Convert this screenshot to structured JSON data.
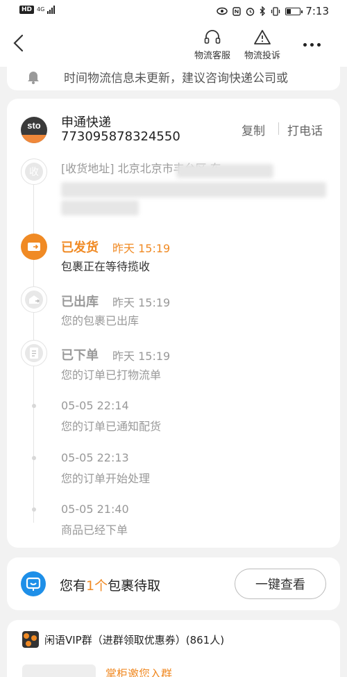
{
  "status_bar": {
    "hd": "HD",
    "network": "4G",
    "time": "7:13"
  },
  "nav": {
    "service_label": "物流客服",
    "complaint_label": "物流投诉"
  },
  "notice": {
    "text": "时间物流信息未更新，建议咨询快递公司或"
  },
  "shipment": {
    "carrier": "申通快递",
    "tracking_number": "773095878324550",
    "copy_label": "复制",
    "call_label": "打电话",
    "logo_text": "sto",
    "receive_label": "收",
    "address": "[收货地址] 北京北京市丰台区 东"
  },
  "timeline": [
    {
      "status": "已发货",
      "time": "昨天 15:19",
      "desc": "包裹正在等待揽收"
    },
    {
      "status": "已出库",
      "time": "昨天 15:19",
      "desc": "您的包裹已出库"
    },
    {
      "status": "已下单",
      "time": "昨天 15:19",
      "desc": "您的订单已打物流单"
    },
    {
      "time": "05-05 22:14",
      "desc": "您的订单已通知配货"
    },
    {
      "time": "05-05 22:13",
      "desc": "您的订单开始处理"
    },
    {
      "time": "05-05 21:40",
      "desc": "商品已经下单"
    }
  ],
  "pickup": {
    "prefix": "您有",
    "count": "1个",
    "suffix": "包裹待取",
    "button": "一键查看"
  },
  "group": {
    "title": "闲语VIP群（进群领取优惠券）(861人)",
    "invite": "掌柜邀您入群"
  },
  "colors": {
    "accent": "#f08a24",
    "pickup_blue": "#1e8fe8"
  }
}
